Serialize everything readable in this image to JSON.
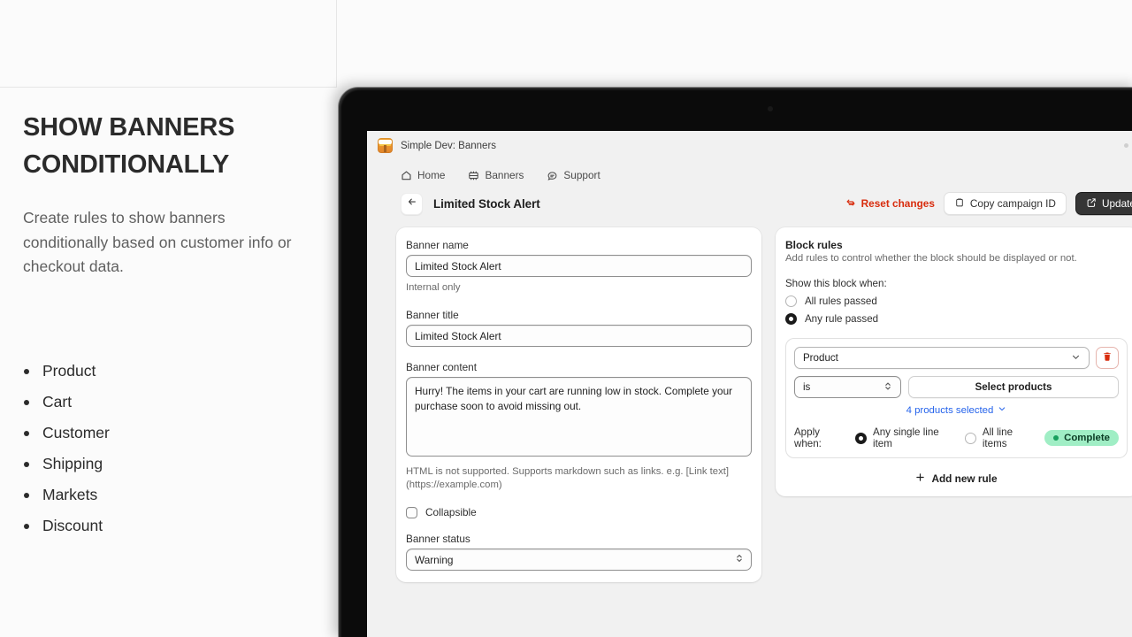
{
  "promo": {
    "heading": "SHOW BANNERS CONDITIONALLY",
    "subtitle": "Create rules to show banners conditionally based on customer info or checkout data.",
    "bullets": [
      "Product",
      "Cart",
      "Customer",
      "Shipping",
      "Markets",
      "Discount"
    ]
  },
  "window": {
    "app_icon": "banner-app-icon",
    "title": "Simple Dev: Banners"
  },
  "topnav": [
    {
      "label": "Home",
      "icon": "home-icon"
    },
    {
      "label": "Banners",
      "icon": "banners-icon"
    },
    {
      "label": "Support",
      "icon": "support-chat-icon"
    }
  ],
  "page": {
    "back_icon": "arrow-left-icon",
    "title": "Limited Stock Alert",
    "actions": {
      "reset": {
        "label": "Reset changes",
        "icon": "reset-icon",
        "color": "#d82c0d"
      },
      "copy": {
        "label": "Copy campaign ID",
        "icon": "clipboard-icon"
      },
      "update": {
        "label": "Update",
        "icon": "external-link-icon"
      }
    }
  },
  "form": {
    "banner_name": {
      "label": "Banner name",
      "value": "Limited Stock Alert",
      "placeholder": "Banner name",
      "help": "Internal only"
    },
    "banner_title": {
      "label": "Banner title",
      "value": "Limited Stock Alert",
      "placeholder": "Banner title"
    },
    "banner_content": {
      "label": "Banner content",
      "value": "Hurry! The items in your cart are running low in stock. Complete your purchase soon to avoid missing out.",
      "placeholder": "Banner content",
      "help": "HTML is not supported. Supports markdown such as links. e.g. [Link text](https://example.com)"
    },
    "collapsible": {
      "label": "Collapsible",
      "checked": false
    },
    "banner_status": {
      "label": "Banner status",
      "value": "Warning"
    }
  },
  "rules": {
    "title": "Block rules",
    "subtitle": "Add rules to control whether the block should be displayed or not.",
    "show_when_label": "Show this block when:",
    "show_when_options": [
      {
        "label": "All rules passed",
        "selected": false
      },
      {
        "label": "Any rule passed",
        "selected": true
      }
    ],
    "rule": {
      "subject": "Product",
      "operator": "is",
      "picker_label": "Select products",
      "selection_summary": "4 products selected",
      "delete_icon": "trash-icon",
      "apply_when_label": "Apply when:",
      "apply_when_options": [
        {
          "label": "Any single line item",
          "selected": true
        },
        {
          "label": "All line items",
          "selected": false
        }
      ],
      "status_badge": "Complete"
    },
    "add_rule_label": "Add new rule"
  }
}
